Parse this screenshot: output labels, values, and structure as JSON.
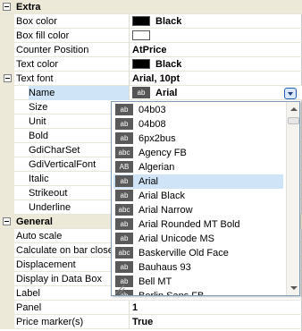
{
  "sections": {
    "extra": "Extra",
    "general": "General"
  },
  "rows": {
    "box_color": {
      "label": "Box color",
      "value": "Black"
    },
    "box_fill_color": {
      "label": "Box fill color",
      "value": ""
    },
    "counter_position": {
      "label": "Counter Position",
      "value": "AtPrice"
    },
    "text_color": {
      "label": "Text color",
      "value": "Black"
    },
    "text_font": {
      "label": "Text font",
      "value": "Arial, 10pt"
    },
    "name": {
      "label": "Name",
      "value": "Arial",
      "badge": "ab"
    },
    "size": {
      "label": "Size"
    },
    "unit": {
      "label": "Unit"
    },
    "bold": {
      "label": "Bold"
    },
    "gdi_charset": {
      "label": "GdiCharSet"
    },
    "gdi_vertical_font": {
      "label": "GdiVerticalFont"
    },
    "italic": {
      "label": "Italic"
    },
    "strikeout": {
      "label": "Strikeout"
    },
    "underline": {
      "label": "Underline"
    },
    "auto_scale": {
      "label": "Auto scale"
    },
    "calc_on_bar_close": {
      "label": "Calculate on bar close"
    },
    "displacement": {
      "label": "Displacement"
    },
    "display_in_data_box": {
      "label": "Display in Data Box"
    },
    "label": {
      "label": "Label"
    },
    "panel": {
      "label": "Panel",
      "value": "1"
    },
    "price_markers": {
      "label": "Price marker(s)",
      "value": "True"
    }
  },
  "font_list": [
    {
      "badge": "ab",
      "name": "04b03"
    },
    {
      "badge": "ab",
      "name": "04b08"
    },
    {
      "badge": "ab",
      "name": "6px2bus"
    },
    {
      "badge": "abc",
      "name": "Agency FB"
    },
    {
      "badge": "AB",
      "name": "Algerian"
    },
    {
      "badge": "ab",
      "name": "Arial"
    },
    {
      "badge": "ab",
      "name": "Arial Black"
    },
    {
      "badge": "abc",
      "name": "Arial Narrow"
    },
    {
      "badge": "ab",
      "name": "Arial Rounded MT Bold"
    },
    {
      "badge": "ab",
      "name": "Arial Unicode MS"
    },
    {
      "badge": "abc",
      "name": "Baskerville Old Face"
    },
    {
      "badge": "ab",
      "name": "Bauhaus 93"
    },
    {
      "badge": "ab",
      "name": "Bell MT"
    },
    {
      "badge": "ab",
      "name": "Berlin Sans FB"
    }
  ],
  "selected_font": "Arial",
  "colors": {
    "selection": "#cfe4f6",
    "category_bg": "#ece9d8",
    "black_swatch": "#000000"
  }
}
